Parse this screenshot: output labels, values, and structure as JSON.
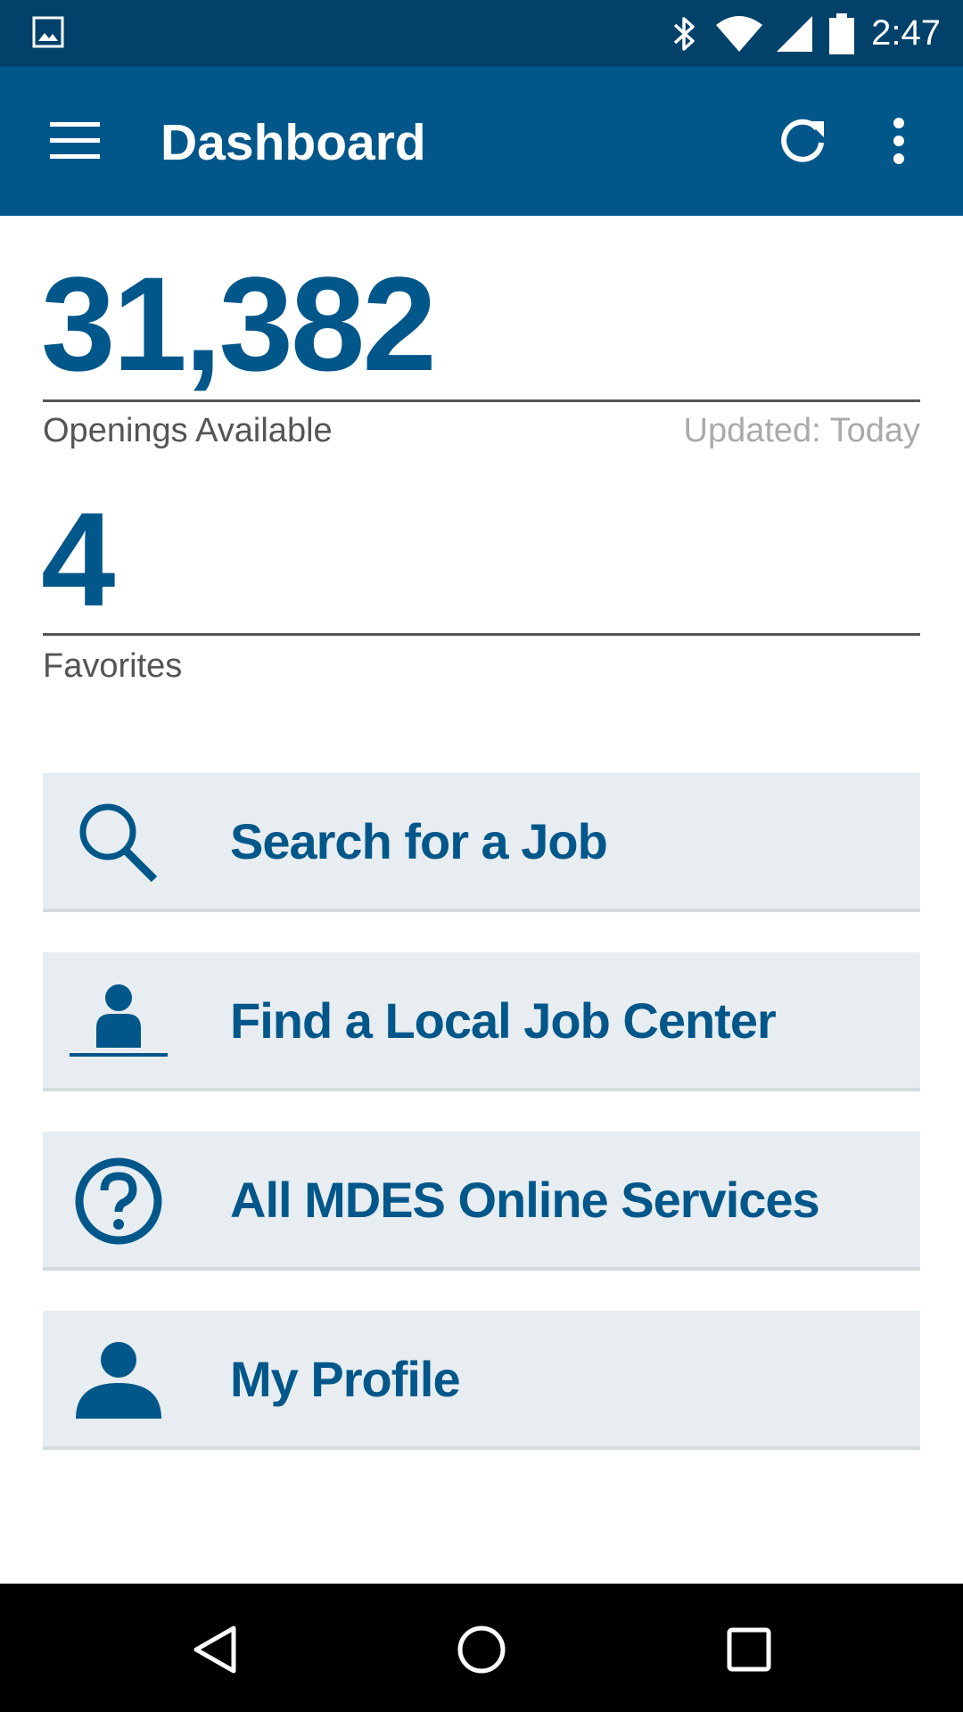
{
  "status_bar": {
    "time": "2:47",
    "icons": [
      "gallery-icon",
      "bluetooth-icon",
      "wifi-icon",
      "signal-icon",
      "battery-icon"
    ]
  },
  "app_bar": {
    "title": "Dashboard",
    "icons": [
      "menu-icon",
      "refresh-icon",
      "overflow-menu-icon"
    ]
  },
  "openings": {
    "value": "31,382",
    "label": "Openings Available",
    "updated": "Updated: Today"
  },
  "favorites": {
    "value": "4",
    "label": "Favorites"
  },
  "actions": [
    {
      "label": "Search for a Job",
      "icon": "search-icon"
    },
    {
      "label": "Find a Local Job Center",
      "icon": "job-center-icon"
    },
    {
      "label": "All MDES Online Services",
      "icon": "help-icon"
    },
    {
      "label": "My Profile",
      "icon": "profile-icon"
    }
  ],
  "colors": {
    "status_bar": "#02426a",
    "app_bar": "#02578a",
    "accent": "#02578a",
    "card_bg": "#e7edf1"
  },
  "nav_bar": {
    "icons": [
      "back-icon",
      "home-icon",
      "recents-icon"
    ]
  }
}
